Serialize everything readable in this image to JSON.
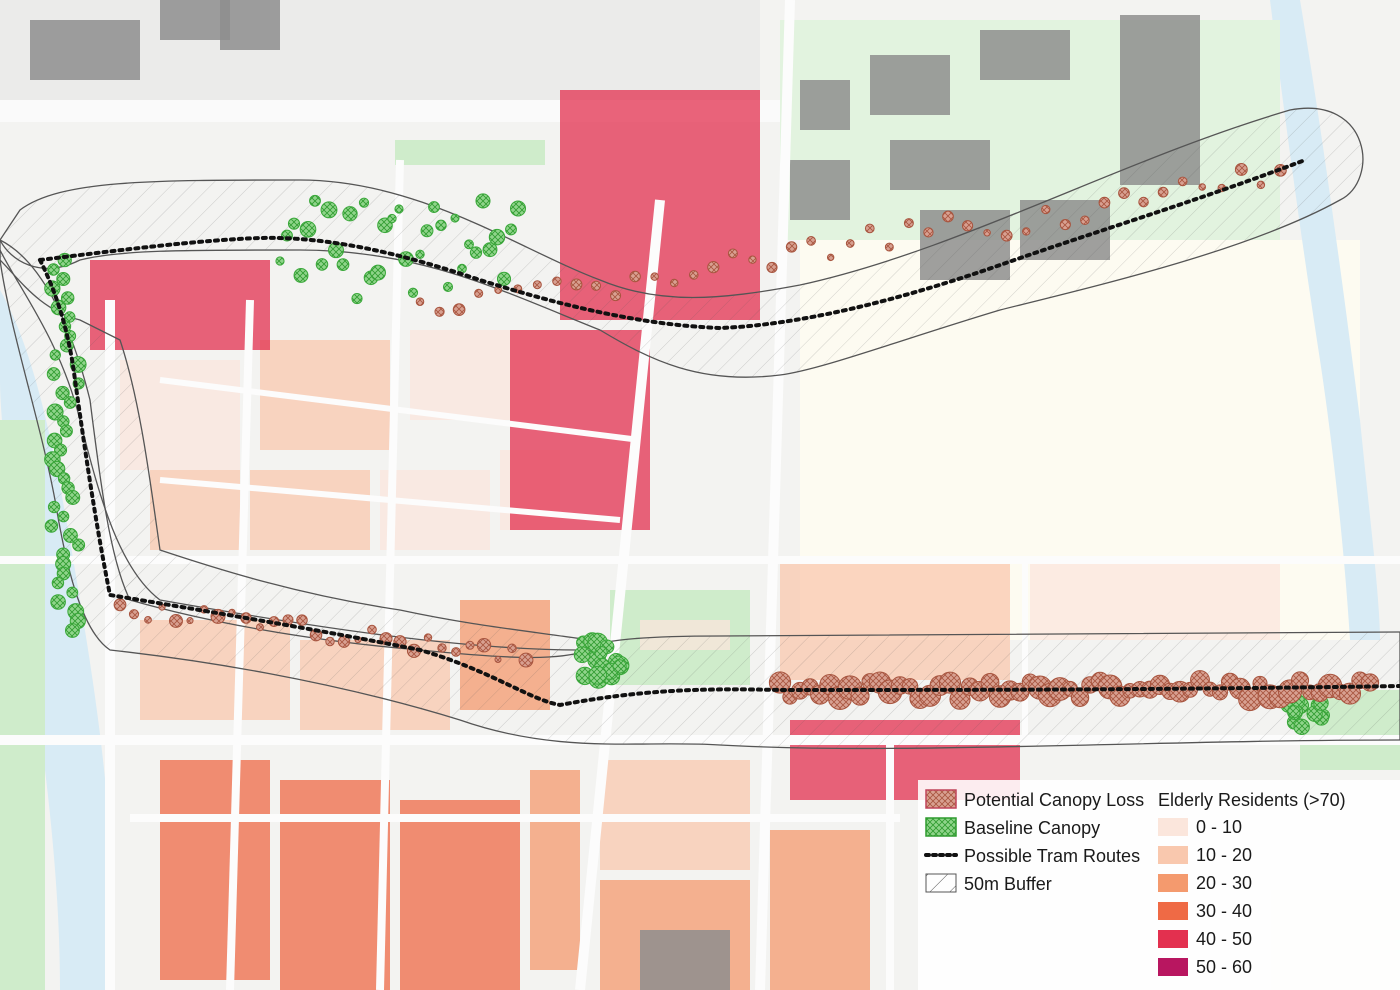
{
  "legend": {
    "canopy_loss": "Potential Canopy Loss",
    "baseline": "Baseline Canopy",
    "tram": "Possible Tram Routes",
    "buffer": "50m Buffer",
    "elderly_title": "Elderly Residents (>70)",
    "classes": [
      {
        "label": "0 - 10",
        "color": "#fbe6dc"
      },
      {
        "label": "10 - 20",
        "color": "#f9c8ae"
      },
      {
        "label": "20 - 30",
        "color": "#f49a6e"
      },
      {
        "label": "30 - 40",
        "color": "#ef6a45"
      },
      {
        "label": "40 - 50",
        "color": "#e3304f"
      },
      {
        "label": "50 - 60",
        "color": "#b81660"
      }
    ]
  },
  "colors": {
    "river": "#d8ebf5",
    "park": "#cfeccb",
    "road": "#fafafa",
    "industrial": "#8e8e8e",
    "loss_fill": "#c98a78",
    "canopy_fill": "#8fd48a",
    "canopy_stroke": "#3aa83a"
  },
  "icons": {
    "buffer_hatch": "diagonal-hatch-icon",
    "tram_line": "dotted-line-icon",
    "canopy": "crosshatch-circle-icon"
  }
}
